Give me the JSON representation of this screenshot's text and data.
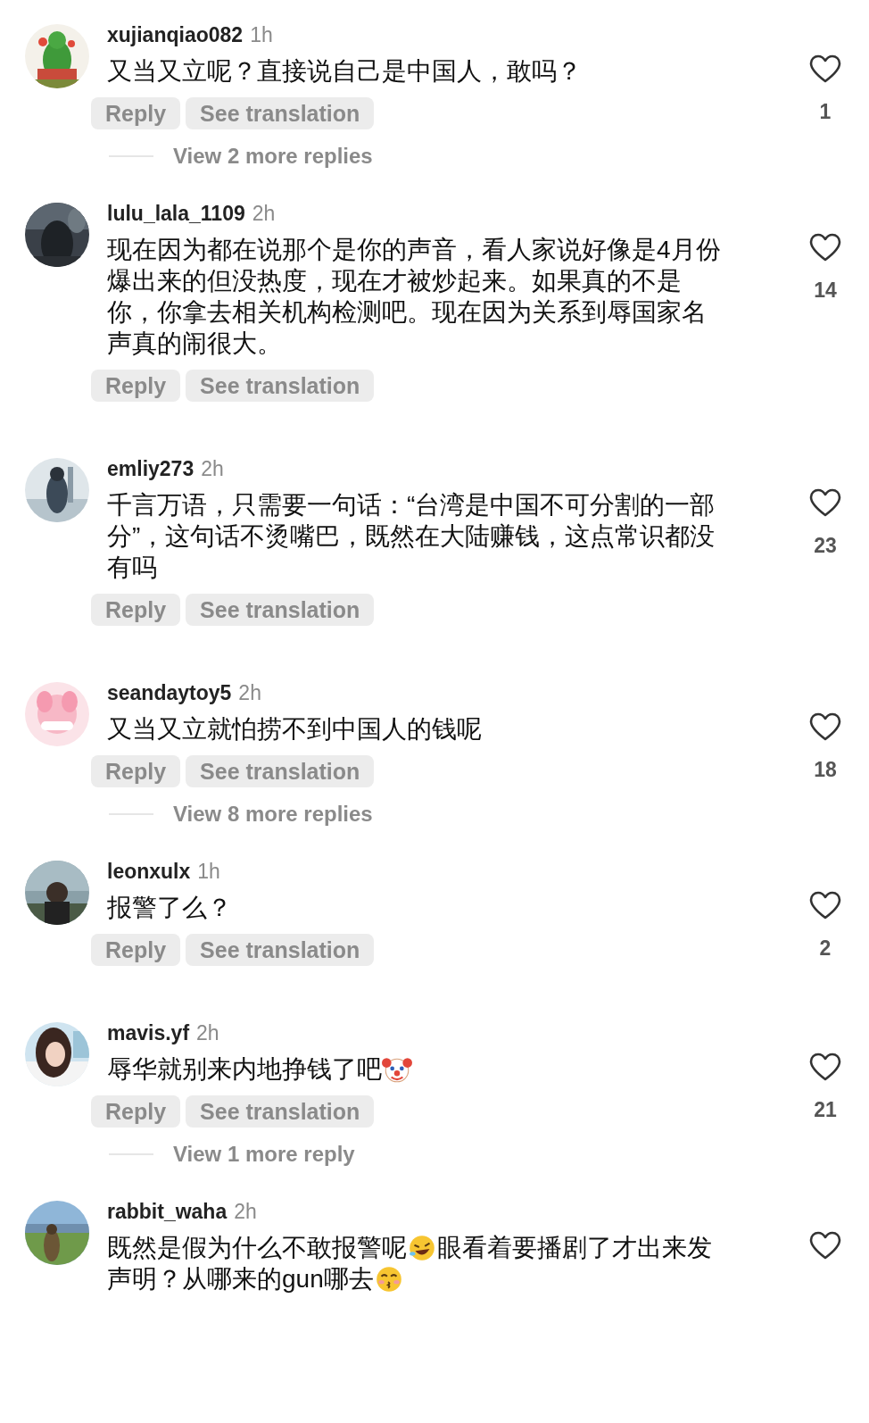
{
  "comments": [
    {
      "username": "xujianqiao082",
      "time": "1h",
      "lines": [
        [
          {
            "kind": "text",
            "text": "又当又立呢？直接说自己是中国人，敢吗？"
          }
        ]
      ],
      "reply": "Reply",
      "translate": "See translation",
      "liked": false,
      "likes": "1",
      "more_replies": "View 2 more replies"
    },
    {
      "username": "lulu_lala_1109",
      "time": "2h",
      "lines": [
        [
          {
            "kind": "text",
            "text": "现在因为都在说那个是你的声音，看人家说好像是4月份"
          }
        ],
        [
          {
            "kind": "text",
            "text": "爆出来的但没热度，现在才被炒起来。如果真的不是"
          }
        ],
        [
          {
            "kind": "text",
            "text": "你，你拿去相关机构检测吧。现在因为关系到辱国家名"
          }
        ],
        [
          {
            "kind": "text",
            "text": "声真的闹很大。"
          }
        ]
      ],
      "reply": "Reply",
      "translate": "See translation",
      "liked": false,
      "likes": "14"
    },
    {
      "username": "emliy273",
      "time": "2h",
      "lines": [
        [
          {
            "kind": "text",
            "text": "千言万语，只需要一句话：“台湾是中国不可分割的一部"
          }
        ],
        [
          {
            "kind": "text",
            "text": "分”，这句话不烫嘴巴，既然在大陆赚钱，这点常识都没"
          }
        ],
        [
          {
            "kind": "text",
            "text": "有吗"
          }
        ]
      ],
      "reply": "Reply",
      "translate": "See translation",
      "liked": false,
      "likes": "23"
    },
    {
      "username": "seandaytoy5",
      "time": "2h",
      "lines": [
        [
          {
            "kind": "text",
            "text": "又当又立就怕捞不到中国人的钱呢"
          }
        ]
      ],
      "reply": "Reply",
      "translate": "See translation",
      "liked": false,
      "likes": "18",
      "more_replies": "View 8 more replies"
    },
    {
      "username": "leonxulx",
      "time": "1h",
      "lines": [
        [
          {
            "kind": "text",
            "text": "报警了么？"
          }
        ]
      ],
      "reply": "Reply",
      "translate": "See translation",
      "liked": false,
      "likes": "2"
    },
    {
      "username": "mavis.yf",
      "time": "2h",
      "lines": [
        [
          {
            "kind": "text",
            "text": "辱华就别来内地挣钱了吧"
          },
          {
            "kind": "clown"
          }
        ]
      ],
      "reply": "Reply",
      "translate": "See translation",
      "liked": false,
      "likes": "21",
      "more_replies": "View 1 more reply"
    },
    {
      "username": "rabbit_waha",
      "time": "2h",
      "lines": [
        [
          {
            "kind": "text",
            "text": "既然是假为什么不敢报警呢"
          },
          {
            "kind": "laughing"
          },
          {
            "kind": "text",
            "text": "眼看着要播剧了才出来发"
          }
        ],
        [
          {
            "kind": "text",
            "text": "声明？从哪来的gun哪去"
          },
          {
            "kind": "kissing"
          }
        ]
      ],
      "liked": false
    }
  ]
}
